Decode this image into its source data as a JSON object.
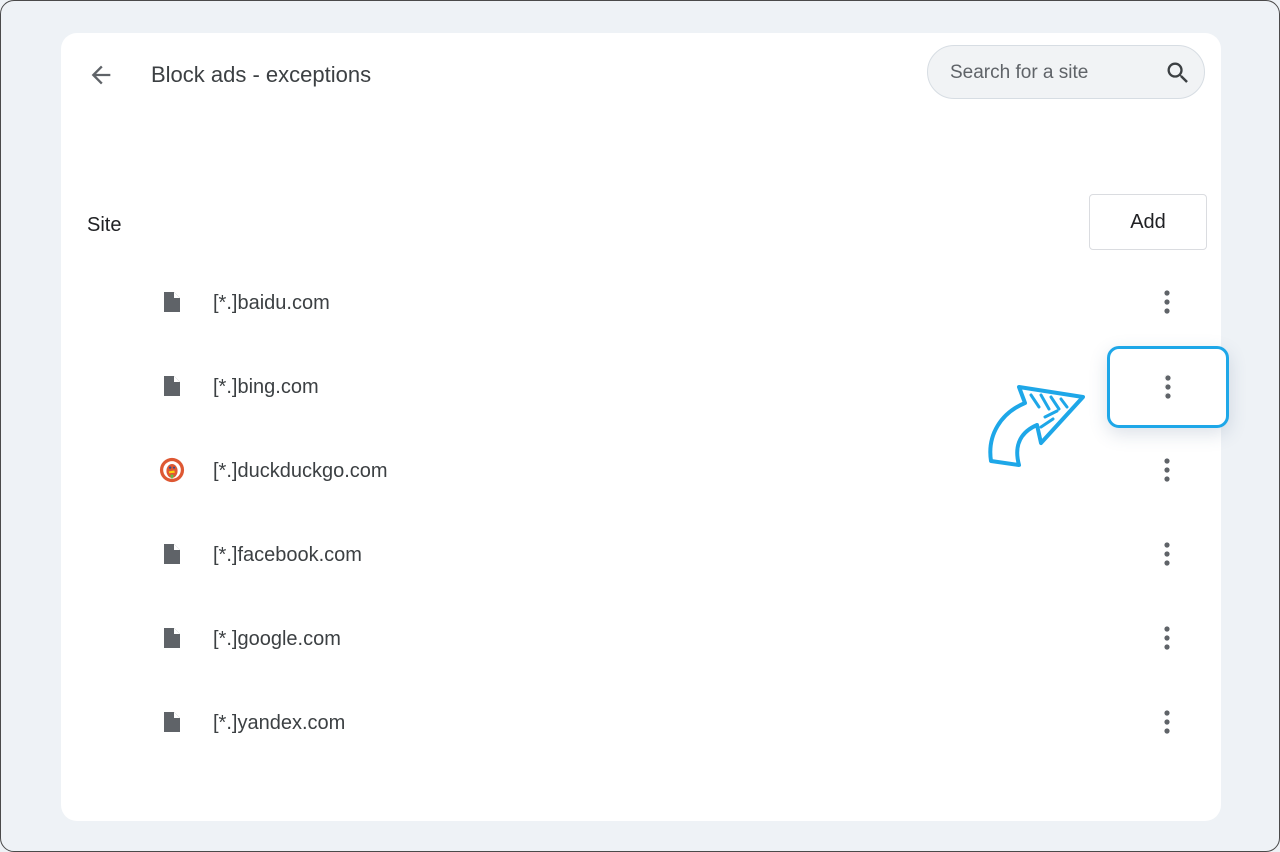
{
  "header": {
    "back_label": "Back",
    "title": "Block ads - exceptions"
  },
  "search": {
    "placeholder": "Search for a site"
  },
  "list": {
    "column_label": "Site",
    "add_label": "Add",
    "sites": [
      {
        "name": "[*.]baidu.com",
        "icon": "file-icon"
      },
      {
        "name": "[*.]bing.com",
        "icon": "file-icon"
      },
      {
        "name": "[*.]duckduckgo.com",
        "icon": "duckduckgo-favicon-icon"
      },
      {
        "name": "[*.]facebook.com",
        "icon": "file-icon"
      },
      {
        "name": "[*.]google.com",
        "icon": "file-icon"
      },
      {
        "name": "[*.]yandex.com",
        "icon": "file-icon"
      }
    ]
  },
  "annotation": {
    "highlighted_row": 1,
    "accent_color": "#1ea7e8"
  },
  "colors": {
    "background": "#eef2f6",
    "card": "#ffffff",
    "text": "#3c4043",
    "icon": "#5f6368"
  }
}
